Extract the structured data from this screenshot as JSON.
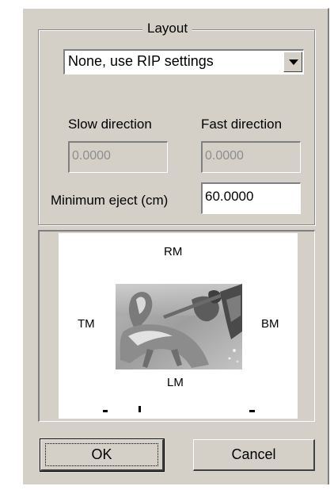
{
  "layout_group": {
    "title": "Layout",
    "layout_select": {
      "selected": "None, use RIP settings",
      "dropdown_icon": "chevron-down-icon"
    },
    "slow_direction": {
      "label": "Slow direction",
      "value": "0.0000",
      "disabled": true
    },
    "fast_direction": {
      "label": "Fast direction",
      "value": "0.0000",
      "disabled": true
    },
    "minimum_eject": {
      "label": "Minimum eject (cm)",
      "value": "60.0000"
    }
  },
  "preview": {
    "top_label": "RM",
    "left_label": "TM",
    "right_label": "BM",
    "bottom_label": "LM",
    "thumbnail": "horse-and-rider-photo"
  },
  "buttons": {
    "ok": "OK",
    "cancel": "Cancel"
  },
  "colors": {
    "dialog_face": "#d4d0c8",
    "disabled_text": "#8e8e8e",
    "field_background": "#ffffff"
  }
}
